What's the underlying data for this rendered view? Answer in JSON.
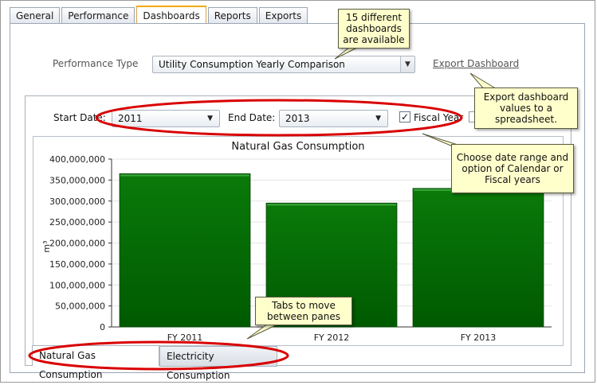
{
  "tabs": [
    {
      "label": "General",
      "active": false
    },
    {
      "label": "Performance",
      "active": false
    },
    {
      "label": "Dashboards",
      "active": true
    },
    {
      "label": "Reports",
      "active": false
    },
    {
      "label": "Exports",
      "active": false
    }
  ],
  "performance": {
    "label": "Performance Type",
    "selected": "Utility Consumption Yearly Comparison",
    "export_link": "Export Dashboard"
  },
  "date_range": {
    "start_label": "Start Date:",
    "start_value": "2011",
    "end_label": "End Date:",
    "end_value": "2013",
    "fiscal_label": "Fiscal Year",
    "fiscal_checked": true
  },
  "callouts": {
    "dashboards": "15 different dashboards are available",
    "export": "Export dashboard values to a spreadsheet.",
    "date": "Choose date range and option of Calendar or Fiscal years",
    "tabs": "Tabs to move between panes"
  },
  "pane_tabs": [
    {
      "label": "Natural Gas Consumption",
      "active": true
    },
    {
      "label": "Electricity Consumption",
      "active": false
    }
  ],
  "colors": {
    "bar_fill": "#0a7a0a",
    "bar_dark": "#005a00",
    "highlight_ellipse": "#d90000",
    "callout_bg": "#ffffcc"
  },
  "chart_data": {
    "type": "bar",
    "title": "Natural Gas Consumption",
    "ylabel": "m³",
    "xlabel": "",
    "categories": [
      "FY 2011",
      "FY 2012",
      "FY 2013"
    ],
    "values": [
      365000000,
      295000000,
      330000000
    ],
    "ylim": [
      0,
      400000000
    ],
    "yticks": [
      0,
      50000000,
      100000000,
      150000000,
      200000000,
      250000000,
      300000000,
      350000000,
      400000000
    ],
    "ytick_labels": [
      "0",
      "50,000,000",
      "100,000,000",
      "150,000,000",
      "200,000,000",
      "250,000,000",
      "300,000,000",
      "350,000,000",
      "400,000,000"
    ],
    "grid": true,
    "legend": "none"
  }
}
